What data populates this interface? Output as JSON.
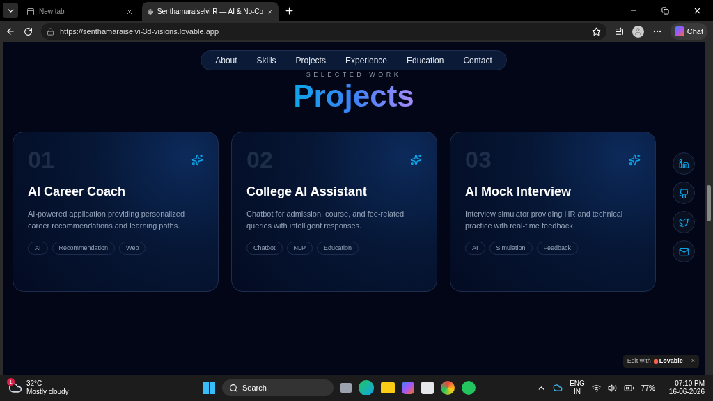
{
  "browser": {
    "tabs": [
      {
        "title": "New tab",
        "selected": false
      },
      {
        "title": "Senthamaraiselvi R — AI & No-Co",
        "selected": true
      }
    ],
    "url": "https://senthamaraiselvi-3d-visions.lovable.app",
    "chat_label": "Chat"
  },
  "nav": [
    "About",
    "Skills",
    "Projects",
    "Experience",
    "Education",
    "Contact"
  ],
  "section": {
    "eyebrow": "SELECTED WORK",
    "title": "Projects"
  },
  "projects": [
    {
      "number": "01",
      "title": "AI Career Coach",
      "description": "AI-powered application providing personalized career recommendations and learning paths.",
      "tags": [
        "AI",
        "Recommendation",
        "Web"
      ]
    },
    {
      "number": "02",
      "title": "College AI Assistant",
      "description": "Chatbot for admission, course, and fee-related queries with intelligent responses.",
      "tags": [
        "Chatbot",
        "NLP",
        "Education"
      ]
    },
    {
      "number": "03",
      "title": "AI Mock Interview",
      "description": "Interview simulator providing HR and technical practice with real-time feedback.",
      "tags": [
        "AI",
        "Simulation",
        "Feedback"
      ]
    }
  ],
  "social": [
    {
      "kind": "linkedin"
    },
    {
      "kind": "github"
    },
    {
      "kind": "twitter"
    },
    {
      "kind": "mail"
    }
  ],
  "badge": {
    "prefix": "Edit with",
    "brand": "Lovable",
    "close": "×"
  },
  "taskbar": {
    "weather_badge": "1",
    "temperature": "32°C",
    "condition": "Mostly cloudy",
    "search": "Search",
    "lang": "ENG",
    "region": "IN",
    "battery": "77%",
    "time": "07:10 PM",
    "date": "16-06-2026"
  }
}
